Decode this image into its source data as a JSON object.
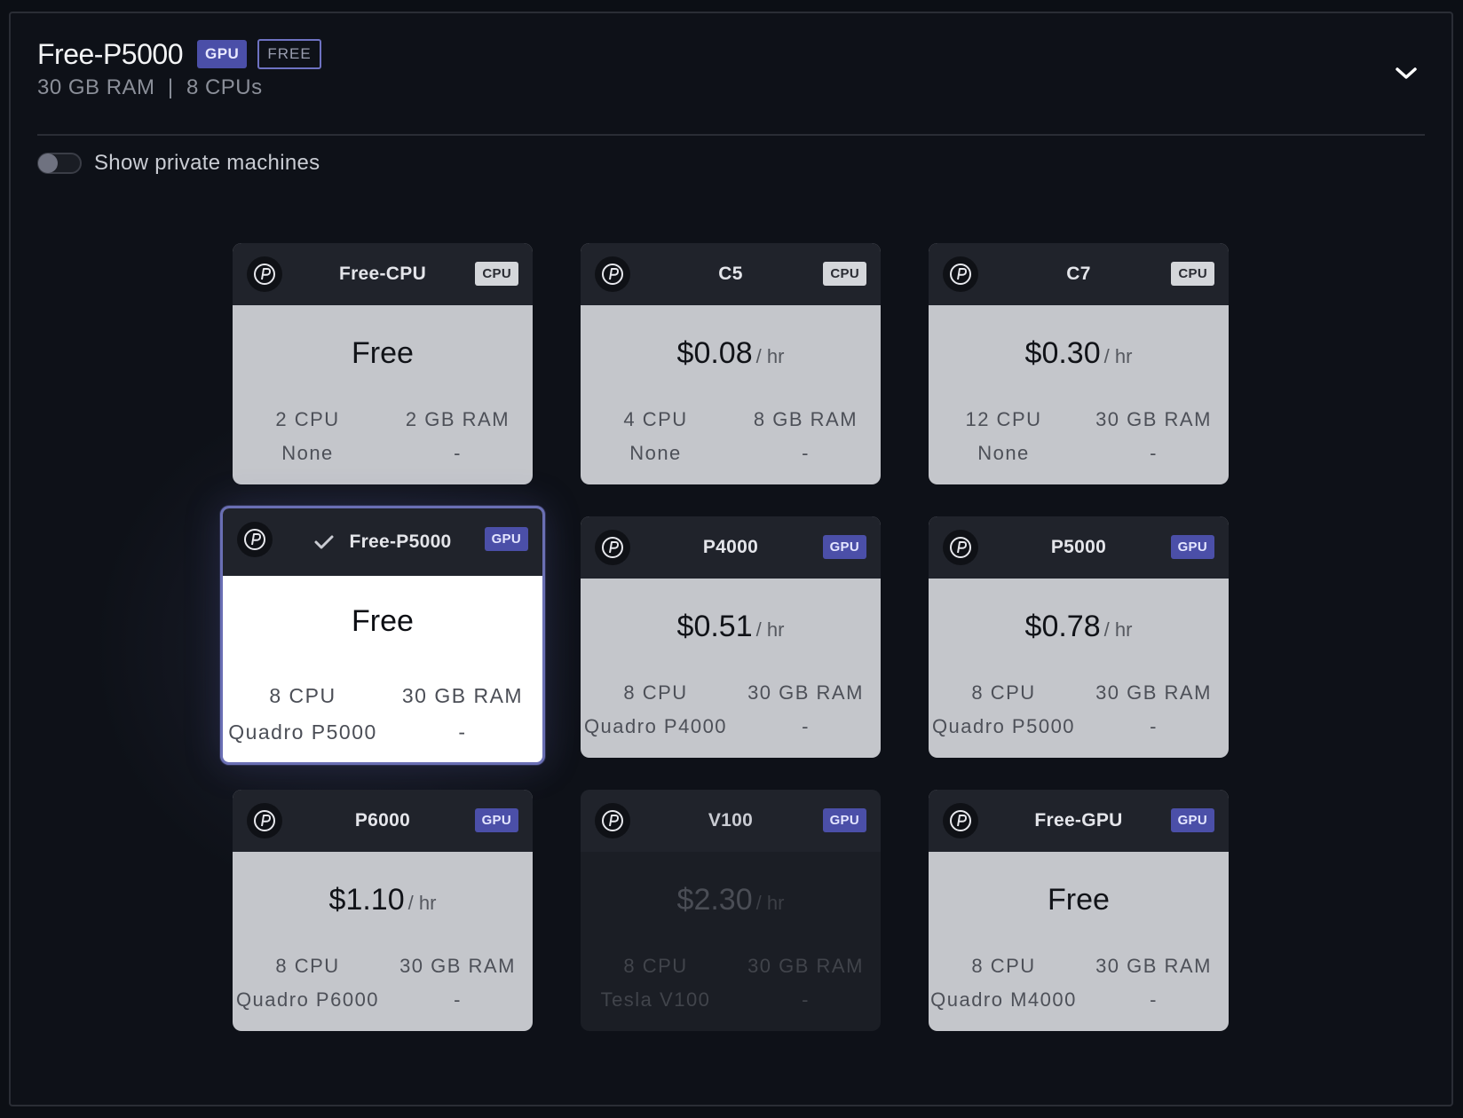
{
  "header": {
    "title": "Free-P5000",
    "type_badge": "GPU",
    "free_badge": "FREE",
    "subtitle": "30 GB RAM  |  8 CPUs"
  },
  "toggle": {
    "label": "Show private machines",
    "on": false
  },
  "machines": [
    {
      "name": "Free-CPU",
      "type": "CPU",
      "price": "Free",
      "unit": "",
      "cpu": "2 CPU",
      "ram": "2 GB RAM",
      "gpu": "None",
      "gpu_ram": "-"
    },
    {
      "name": "C5",
      "type": "CPU",
      "price": "$0.08",
      "unit": "/ hr",
      "cpu": "4 CPU",
      "ram": "8 GB RAM",
      "gpu": "None",
      "gpu_ram": "-"
    },
    {
      "name": "C7",
      "type": "CPU",
      "price": "$0.30",
      "unit": "/ hr",
      "cpu": "12 CPU",
      "ram": "30 GB RAM",
      "gpu": "None",
      "gpu_ram": "-"
    },
    {
      "name": "Free-P5000",
      "type": "GPU",
      "price": "Free",
      "unit": "",
      "cpu": "8 CPU",
      "ram": "30 GB RAM",
      "gpu": "Quadro P5000",
      "gpu_ram": "-",
      "selected": true
    },
    {
      "name": "P4000",
      "type": "GPU",
      "price": "$0.51",
      "unit": "/ hr",
      "cpu": "8 CPU",
      "ram": "30 GB RAM",
      "gpu": "Quadro P4000",
      "gpu_ram": "-"
    },
    {
      "name": "P5000",
      "type": "GPU",
      "price": "$0.78",
      "unit": "/ hr",
      "cpu": "8 CPU",
      "ram": "30 GB RAM",
      "gpu": "Quadro P5000",
      "gpu_ram": "-"
    },
    {
      "name": "P6000",
      "type": "GPU",
      "price": "$1.10",
      "unit": "/ hr",
      "cpu": "8 CPU",
      "ram": "30 GB RAM",
      "gpu": "Quadro P6000",
      "gpu_ram": "-"
    },
    {
      "name": "V100",
      "type": "GPU",
      "price": "$2.30",
      "unit": "/ hr",
      "cpu": "8 CPU",
      "ram": "30 GB RAM",
      "gpu": "Tesla V100",
      "gpu_ram": "-",
      "disabled": true
    },
    {
      "name": "Free-GPU",
      "type": "GPU",
      "price": "Free",
      "unit": "",
      "cpu": "8 CPU",
      "ram": "30 GB RAM",
      "gpu": "Quadro M4000",
      "gpu_ram": "-"
    }
  ],
  "icons": {
    "logo": "paperspace-logo-icon",
    "collapse": "chevron-down-icon",
    "check": "check-icon"
  }
}
